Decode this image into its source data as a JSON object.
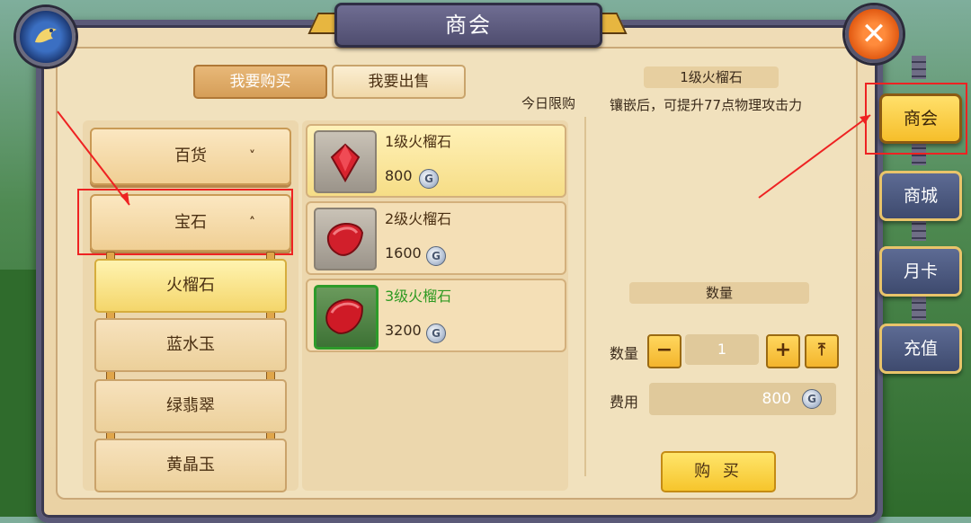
{
  "window": {
    "title": "商会"
  },
  "tabs": {
    "buy_label": "我要购买",
    "sell_label": "我要出售"
  },
  "daily_limit_label": "今日限购",
  "categories": [
    {
      "label": "百货",
      "chevron": "˅"
    },
    {
      "label": "宝石",
      "chevron": "˄"
    }
  ],
  "subcategories": [
    "火榴石",
    "蓝水玉",
    "绿翡翠",
    "黄晶玉"
  ],
  "items": [
    {
      "name": "1级火榴石",
      "price": "800"
    },
    {
      "name": "2级火榴石",
      "price": "1600"
    },
    {
      "name": "3级火榴石",
      "price": "3200"
    }
  ],
  "currency_icon": "coin-icon",
  "currency_symbol": "G",
  "detail": {
    "title": "1级火榴石",
    "description": "镶嵌后，可提升77点物理攻击力",
    "quantity_header": "数量",
    "quantity_label": "数量",
    "quantity_value": "1",
    "minus_label": "−",
    "plus_label": "+",
    "max_label": "⤒",
    "fee_label": "费用",
    "fee_value": "800",
    "buy_label": "购 买"
  },
  "side_menu": [
    "商会",
    "商城",
    "月卡",
    "充值"
  ],
  "close_label": "✕",
  "colors": {
    "highlight_red": "#e22222",
    "gold": "#f6c52c",
    "panel": "#efdcb6"
  }
}
